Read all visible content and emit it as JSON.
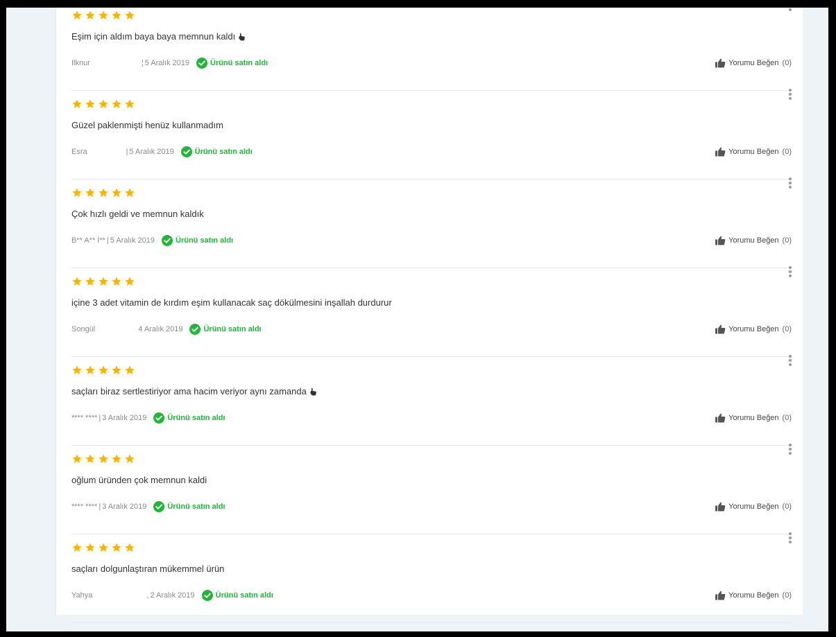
{
  "like_label": "Yorumu Beğen",
  "verified_label": "Ürünü satın aldı",
  "star_color": "#f7b500",
  "verified_color": "#21b53a",
  "reviews": [
    {
      "stars": 5,
      "comment": "Eşim için aldım baya baya memnun kaldı",
      "has_hand": true,
      "author": "Ilknur",
      "sep": "¦",
      "date": "5 Aralık 2019",
      "likes": "(0)"
    },
    {
      "stars": 5,
      "comment": "Güzel paklenmişti henüz kullanmadım",
      "has_hand": false,
      "author": "Esra",
      "sep": "|",
      "date": "5 Aralık 2019",
      "likes": "(0)"
    },
    {
      "stars": 5,
      "comment": "Çok hızlı geldi ve memnun kaldık",
      "has_hand": false,
      "author": "B** A** İ**",
      "sep": "|",
      "date": "5 Aralık 2019",
      "likes": "(0)"
    },
    {
      "stars": 5,
      "comment": "içine 3 adet vitamin de kırdım eşim kullanacak saç dökülmesini inşallah durdurur",
      "has_hand": false,
      "author": "Songül",
      "sep": "",
      "date": "4 Aralık 2019",
      "likes": "(0)"
    },
    {
      "stars": 5,
      "comment": "saçları biraz sertlestiriyor ama hacim veriyor aynı zamanda",
      "has_hand": true,
      "author": "**** ****",
      "sep": "|",
      "date": "3 Aralık 2019",
      "likes": "(0)"
    },
    {
      "stars": 5,
      "comment": "oğlum üründen çok memnun kaldi",
      "has_hand": false,
      "author": "**** ****",
      "sep": "|",
      "date": "3 Aralık 2019",
      "likes": "(0)"
    },
    {
      "stars": 5,
      "comment": "saçları dolgunlaştıran mükemmel ürün",
      "has_hand": false,
      "author": "Yahya",
      "sep": ",",
      "date": "2 Aralık 2019",
      "likes": "(0)"
    }
  ]
}
